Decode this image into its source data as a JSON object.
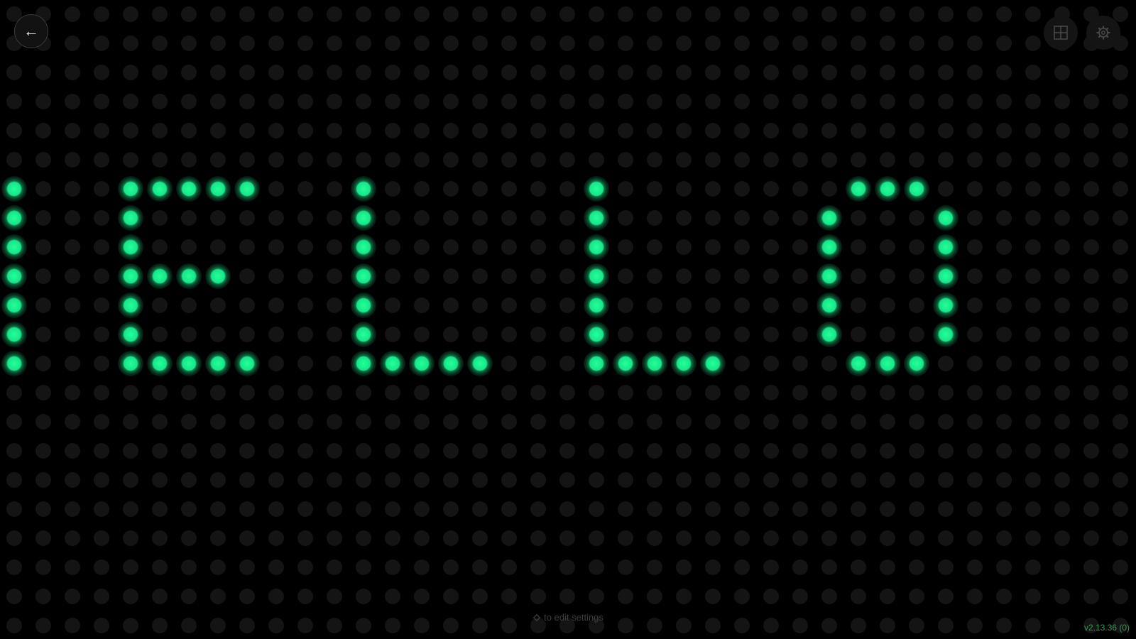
{
  "display": {
    "message": "HELLO",
    "led_color": "#18e58a",
    "led_off_color": "#141414",
    "background": "#000000"
  },
  "toolbar": {
    "back_icon": "arrow-left-icon",
    "back_glyph": "←",
    "grid_icon": "grid-icon",
    "settings_icon": "gear-icon"
  },
  "footer": {
    "hint_icon": "gear-icon",
    "hint_text": "to edit settings",
    "version": "v2.13.36 (0)"
  }
}
